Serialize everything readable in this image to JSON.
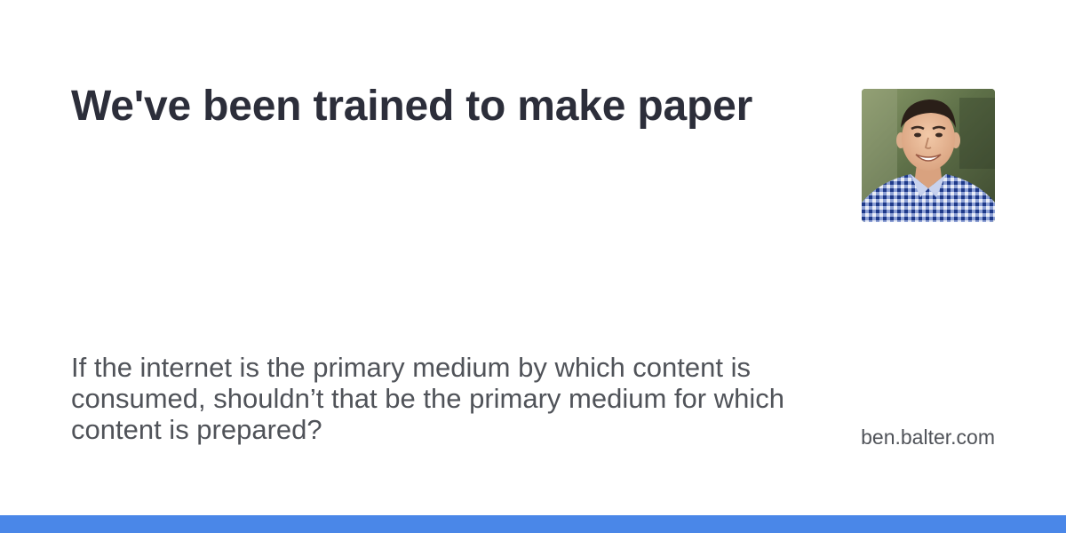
{
  "card": {
    "title": "We've been trained to make paper",
    "description": "If the internet is the primary medium by which content is consumed, shouldn’t that be the primary medium for which content is prepared?",
    "site": "ben.balter.com"
  },
  "avatar": {
    "icon": "author-photo"
  },
  "colors": {
    "accent_bar": "#4a87e8",
    "title_text": "#2c2e3a",
    "body_text": "#505359",
    "background": "#ffffff"
  }
}
